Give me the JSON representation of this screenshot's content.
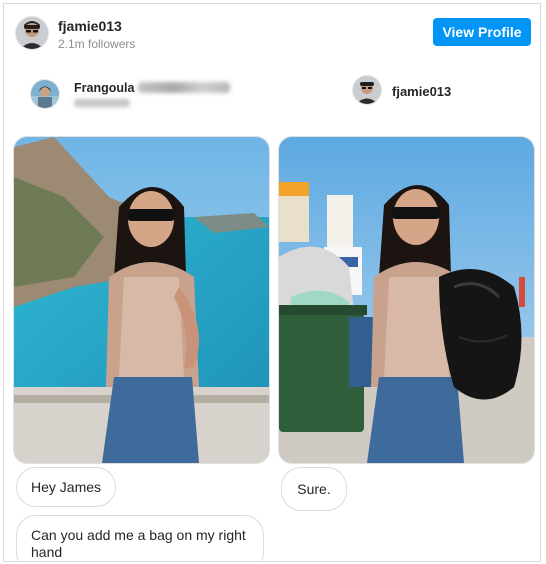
{
  "header": {
    "username": "fjamie013",
    "followers": "2.1m followers",
    "view_profile_label": "View Profile"
  },
  "post": {
    "left_user": {
      "name": "Frangoula",
      "name_redacted": "Christine Diak",
      "handle_redacted": "fra_diakoly"
    },
    "right_user": {
      "name": "fjamie013"
    }
  },
  "images": {
    "left_alt": "Woman in sunglasses posing by turquoise sea and cliffs",
    "right_alt": "Same woman posing next to a garbage bin holding a black trash bag"
  },
  "messages": {
    "left": [
      "Hey James",
      "Can you add me a bag on my right hand"
    ],
    "right": [
      "Sure."
    ]
  },
  "colors": {
    "accent": "#0095f6",
    "border": "#dbdbdb",
    "text": "#262626",
    "muted": "#8e8e8e"
  }
}
